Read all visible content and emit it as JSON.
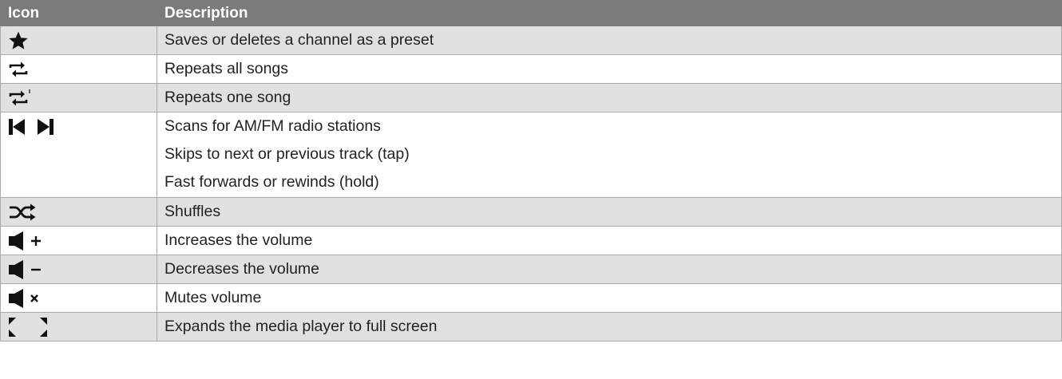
{
  "table": {
    "headers": {
      "icon": "Icon",
      "description": "Description"
    },
    "rows": [
      {
        "icon": "star-icon",
        "description": [
          "Saves or deletes a channel as a preset"
        ]
      },
      {
        "icon": "repeat-all-icon",
        "description": [
          "Repeats all songs"
        ]
      },
      {
        "icon": "repeat-one-icon",
        "description": [
          "Repeats one song"
        ]
      },
      {
        "icon": "skip-prev-next-icon",
        "description": [
          "Scans for AM/FM radio stations",
          "Skips to next or previous track (tap)",
          "Fast forwards or rewinds (hold)"
        ]
      },
      {
        "icon": "shuffle-icon",
        "description": [
          "Shuffles"
        ]
      },
      {
        "icon": "volume-up-icon",
        "description": [
          "Increases the volume"
        ]
      },
      {
        "icon": "volume-down-icon",
        "description": [
          "Decreases the volume"
        ]
      },
      {
        "icon": "mute-icon",
        "description": [
          "Mutes volume"
        ]
      },
      {
        "icon": "fullscreen-icon",
        "description": [
          "Expands the media player to full screen"
        ]
      }
    ]
  }
}
